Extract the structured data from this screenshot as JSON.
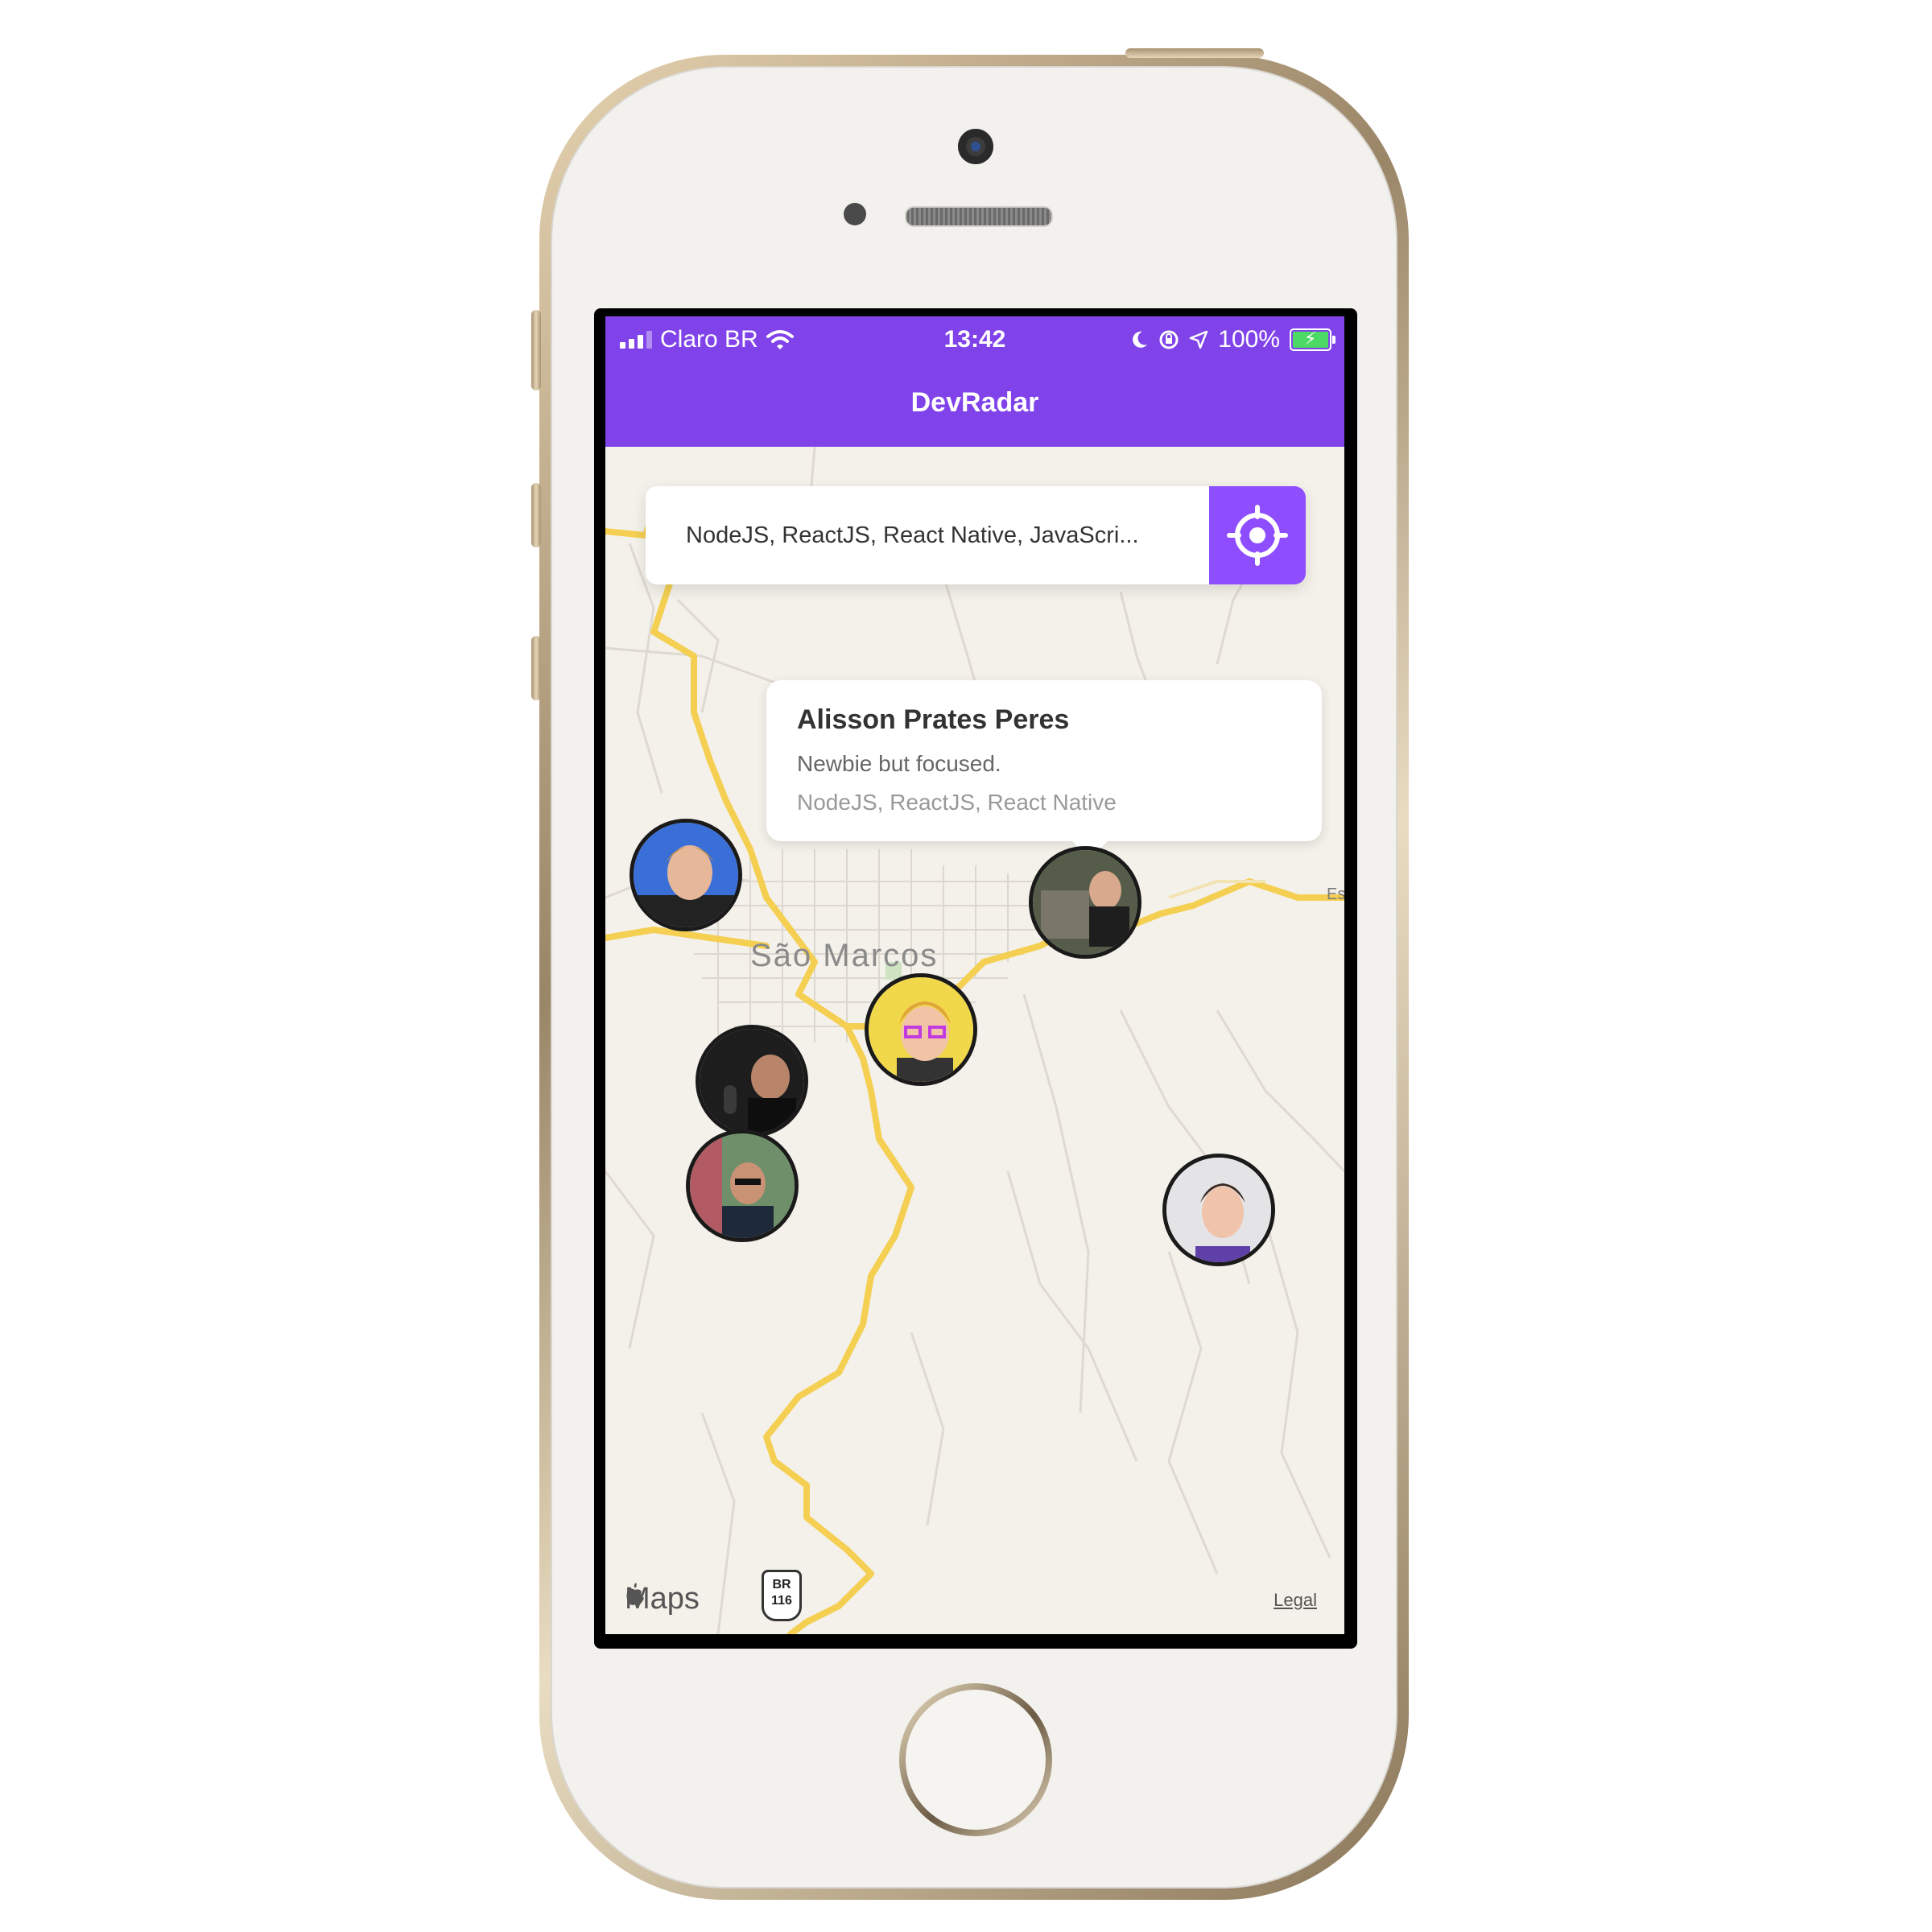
{
  "status_bar": {
    "carrier": "Claro BR",
    "time": "13:42",
    "battery_percent": "100%",
    "icons": [
      "signal-icon",
      "wifi-icon",
      "moon-icon",
      "rotation-lock-icon",
      "location-arrow-icon",
      "battery-charging-icon"
    ]
  },
  "app": {
    "title": "DevRadar",
    "accent_color": "#8043e9",
    "button_color": "#8e4dff"
  },
  "search": {
    "value": "NodeJS, ReactJS, React Native, JavaScri...",
    "locate_icon": "crosshair-icon"
  },
  "map": {
    "city_label": "São Marcos",
    "edge_label": "Es",
    "attribution": "Maps",
    "road_shield_top": "BR",
    "road_shield_number": "116",
    "legal_label": "Legal"
  },
  "callout": {
    "name": "Alisson Prates Peres",
    "bio": "Newbie but focused.",
    "techs": "NodeJS, ReactJS, React Native"
  },
  "markers": [
    {
      "id": "dev-1",
      "bg": "#3a6fd8"
    },
    {
      "id": "dev-2",
      "bg": "#555c4a"
    },
    {
      "id": "dev-3",
      "bg": "#f0d84a"
    },
    {
      "id": "dev-4",
      "bg": "#1d1d1d"
    },
    {
      "id": "dev-5",
      "bg": "#6f8f6a"
    },
    {
      "id": "dev-6",
      "bg": "#e4e4e6"
    }
  ]
}
